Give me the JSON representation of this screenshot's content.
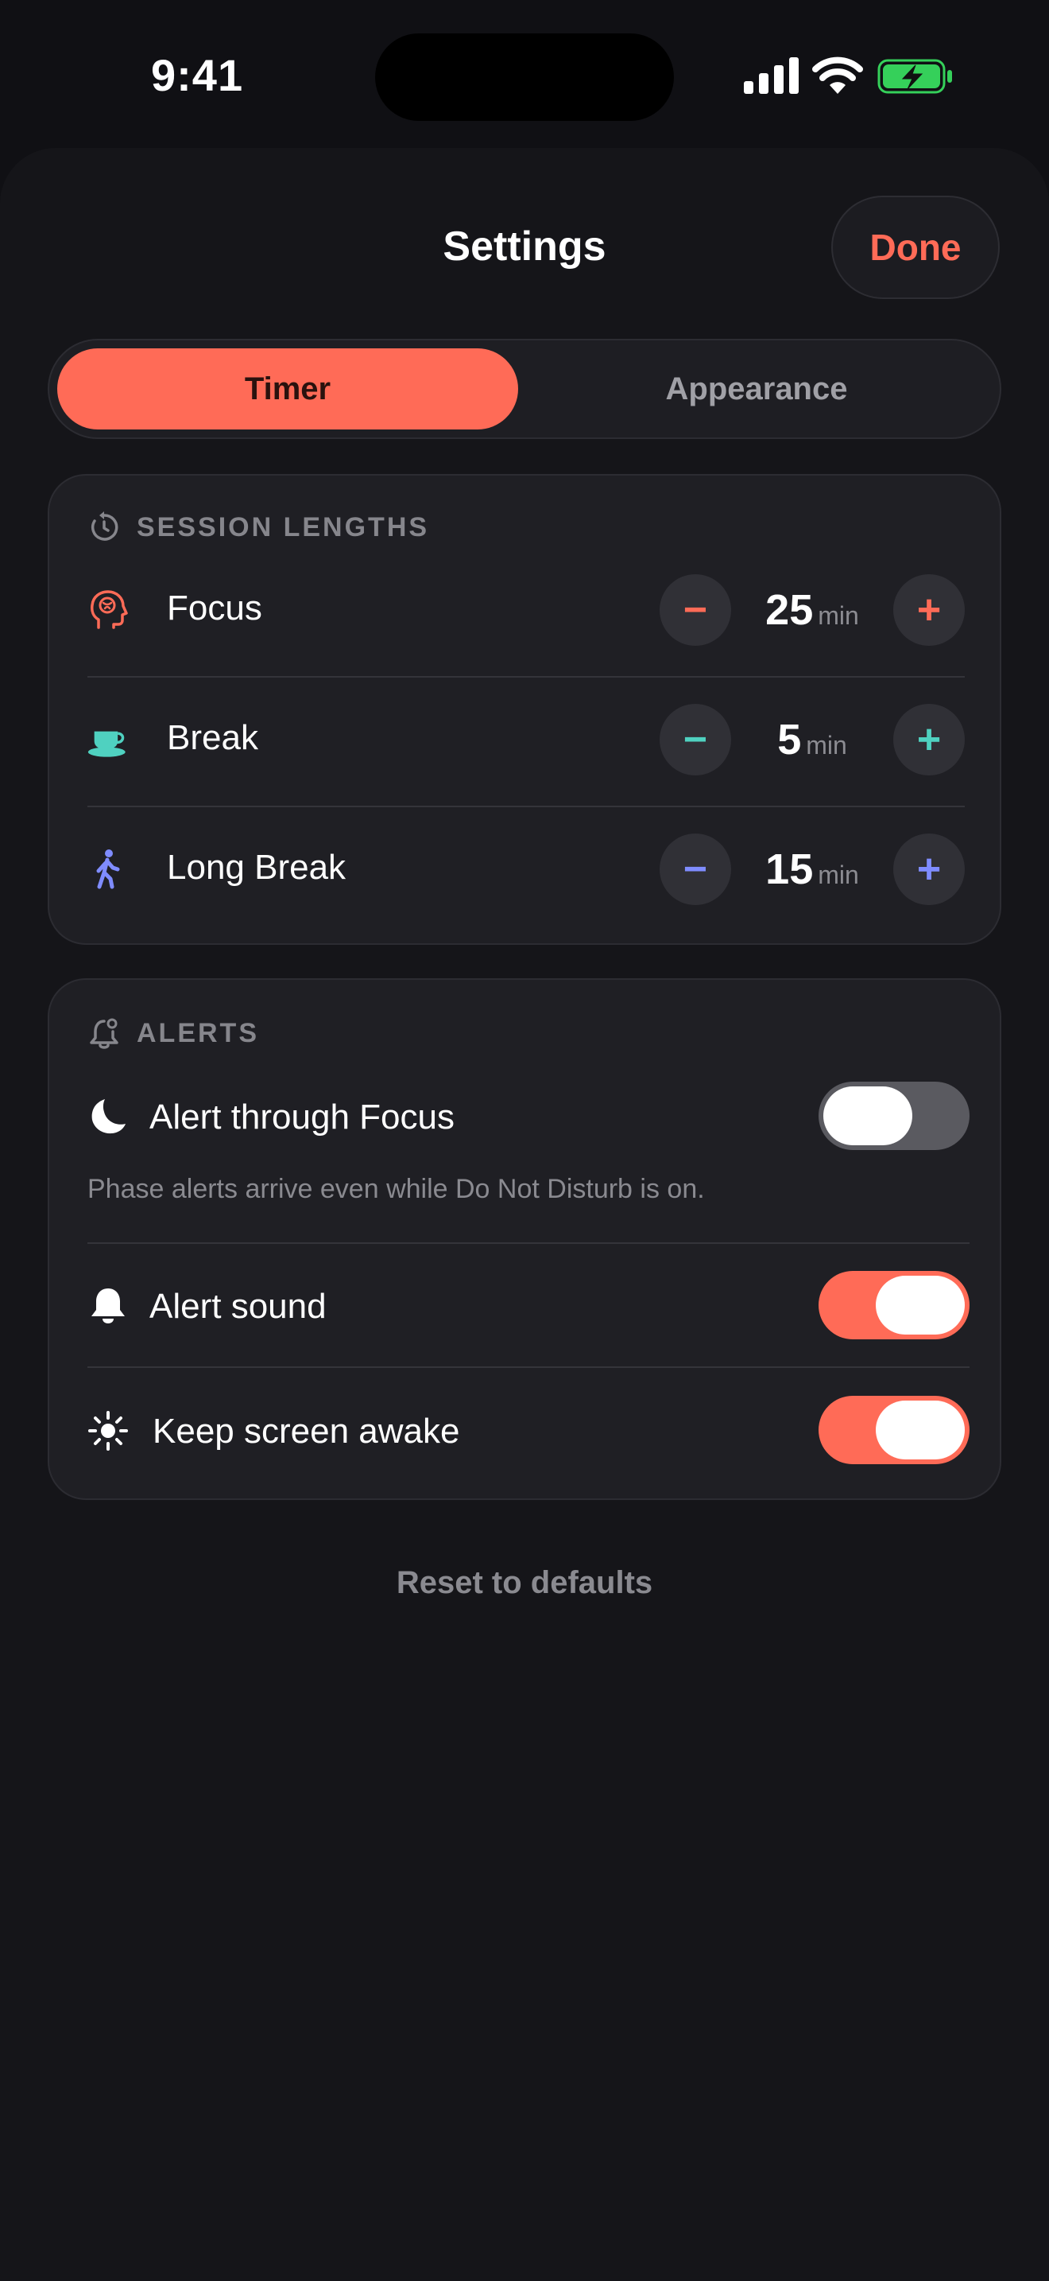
{
  "status_bar": {
    "time": "9:41"
  },
  "header": {
    "title": "Settings",
    "done_label": "Done"
  },
  "tabs": [
    {
      "label": "Timer",
      "active": true
    },
    {
      "label": "Appearance",
      "active": false
    }
  ],
  "session_lengths": {
    "heading": "SESSION LENGTHS",
    "items": [
      {
        "label": "Focus",
        "value": "25",
        "unit": "min",
        "icon": "brain-head-icon",
        "accent": "#ff6b57"
      },
      {
        "label": "Break",
        "value": "5",
        "unit": "min",
        "icon": "coffee-cup-icon",
        "accent": "#4fd1c0"
      },
      {
        "label": "Long Break",
        "value": "15",
        "unit": "min",
        "icon": "walking-figure-icon",
        "accent": "#7f8cff"
      }
    ]
  },
  "alerts": {
    "heading": "ALERTS",
    "items": [
      {
        "label": "Alert through Focus",
        "on": false,
        "icon": "moon-icon"
      },
      {
        "label": "Alert sound",
        "on": true,
        "icon": "bell-icon"
      },
      {
        "label": "Keep screen awake",
        "on": true,
        "icon": "sun-icon"
      }
    ],
    "note": "Phase alerts arrive even while Do Not Disturb is on."
  },
  "reset_label": "Reset to defaults",
  "colors": {
    "accent": "#ff6b57",
    "break": "#4fd1c0",
    "long_break": "#7f8cff",
    "battery": "#35d05a"
  }
}
